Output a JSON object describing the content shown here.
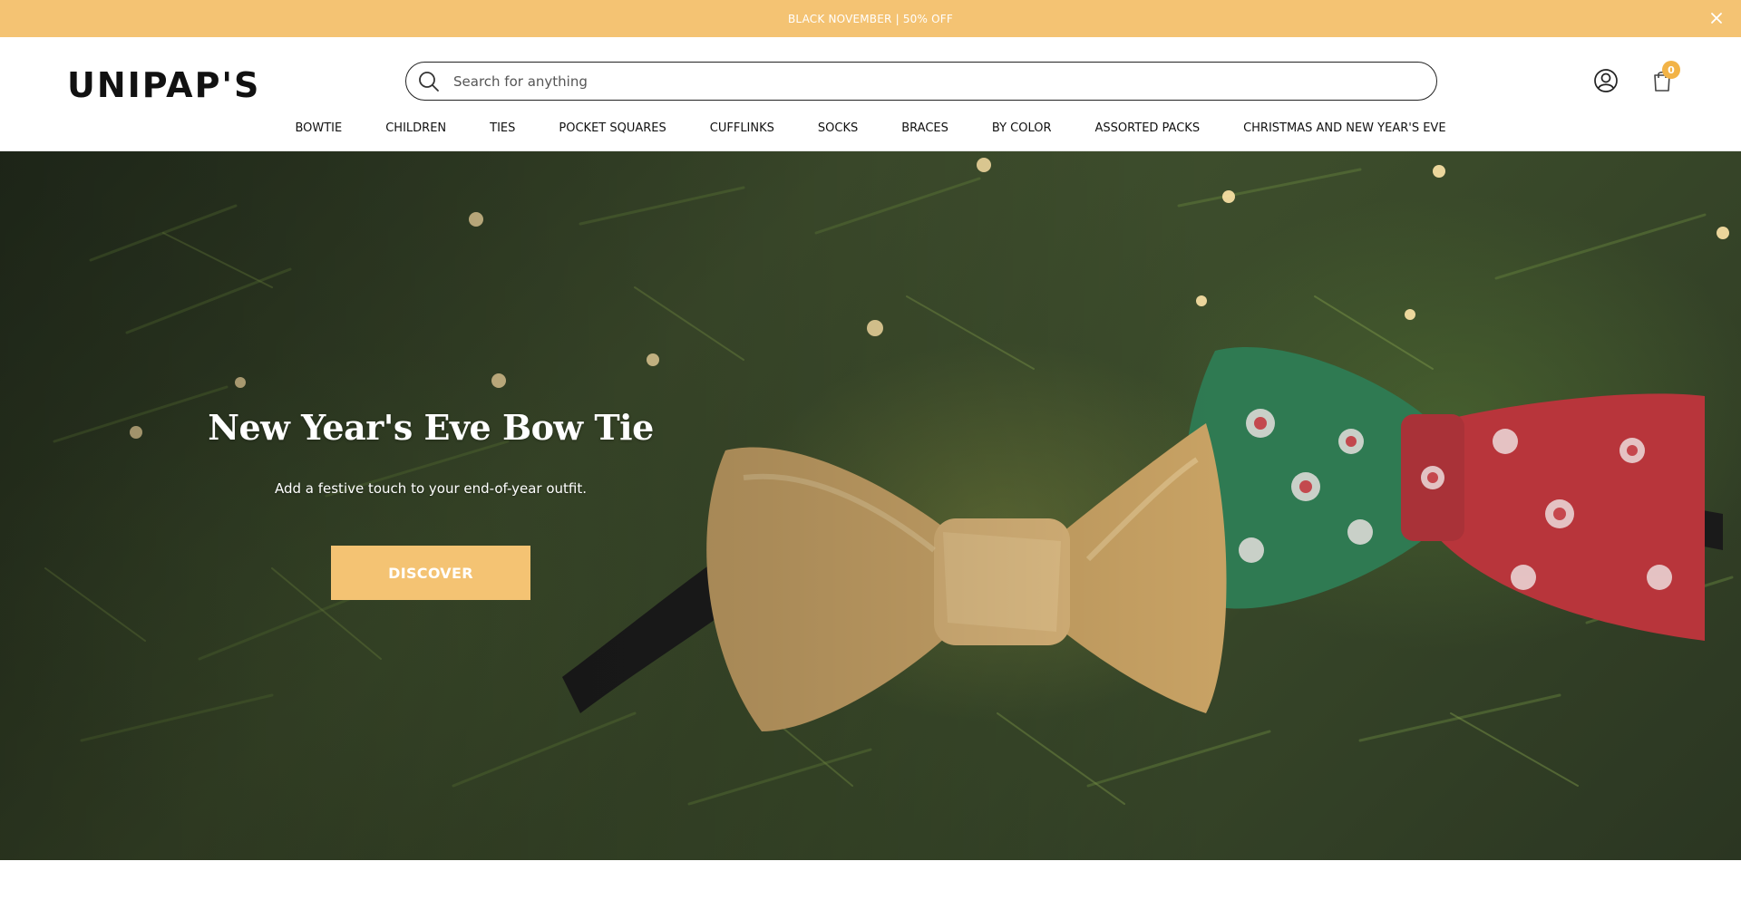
{
  "announcement": {
    "text": "BLACK NOVEMBER | 50% OFF",
    "close_icon": "close-icon"
  },
  "header": {
    "logo_text": "UNIPAP'S",
    "search": {
      "placeholder": "Search for anything",
      "value": "",
      "icon": "search-icon"
    },
    "account_icon": "user-icon",
    "cart_icon": "shopping-bag-icon",
    "cart_count": "0"
  },
  "nav": {
    "items": [
      {
        "label": "BOWTIE"
      },
      {
        "label": "CHILDREN"
      },
      {
        "label": "TIES"
      },
      {
        "label": "POCKET SQUARES"
      },
      {
        "label": "CUFFLINKS"
      },
      {
        "label": "SOCKS"
      },
      {
        "label": "BRACES"
      },
      {
        "label": "BY COLOR"
      },
      {
        "label": "ASSORTED PACKS"
      },
      {
        "label": "CHRISTMAS AND NEW YEAR'S EVE"
      }
    ]
  },
  "hero": {
    "title": "New Year's Eve Bow Tie",
    "subtitle": "Add a festive touch to your end-of-year outfit.",
    "button_label": "DISCOVER",
    "image_description_icon": "bow-tie-image"
  },
  "colors": {
    "accent": "#f4c373",
    "cart_badge": "#f2b347",
    "text": "#111111"
  }
}
